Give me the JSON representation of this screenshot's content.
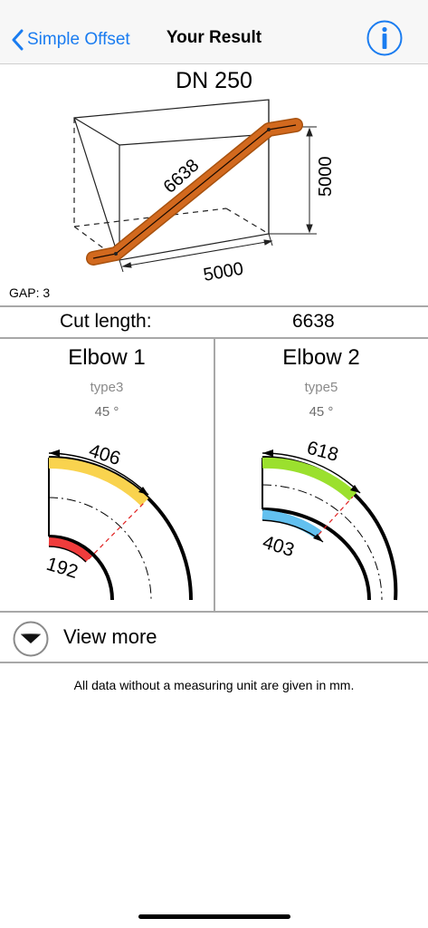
{
  "nav": {
    "back_label": "Simple Offset",
    "title": "Your Result"
  },
  "diagram": {
    "title": "DN 250",
    "length_label": "6638",
    "height_label": "5000",
    "width_label": "5000",
    "gap_label": "GAP: 3",
    "pipe_color": "#d2691e"
  },
  "cut": {
    "label": "Cut length:",
    "value": "6638"
  },
  "elbows": [
    {
      "title": "Elbow 1",
      "type": "type3",
      "angle": "45 °",
      "outer_value": "406",
      "inner_value": "192",
      "outer_color": "#f9d34e",
      "inner_color": "#f03c3c"
    },
    {
      "title": "Elbow 2",
      "type": "type5",
      "angle": "45 °",
      "outer_value": "618",
      "inner_value": "403",
      "outer_color": "#9be02e",
      "inner_color": "#62c0ef"
    }
  ],
  "view_more": {
    "label": "View more",
    "icon": "chevron-down-circle-icon"
  },
  "footnote": "All data without a measuring unit are given in mm."
}
